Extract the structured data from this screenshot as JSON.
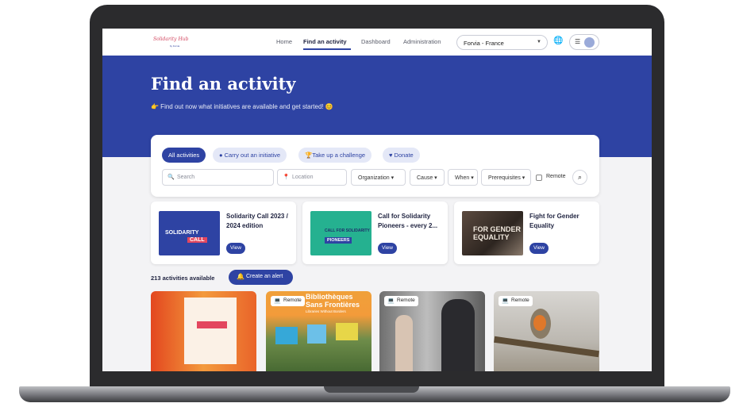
{
  "logo": {
    "text": "Solidarity Hub",
    "sub": "by Forvia"
  },
  "nav": {
    "links": [
      "Home",
      "Find an activity",
      "Dashboard",
      "Administration"
    ],
    "site_select": "Forvia - France"
  },
  "hero": {
    "title": "Find an activity",
    "subtitle": "👉 Find out now what initiatives are available and get started! 😊"
  },
  "filters": {
    "chips": [
      "All activities",
      "Carry out an initiative",
      "Take up a challenge",
      "Donate"
    ],
    "search_placeholder": "Search",
    "location_placeholder": "Location",
    "dropdowns": [
      "Organization ▾",
      "Cause ▾",
      "When ▾",
      "Prerequisites ▾"
    ],
    "remote_label": "Remote"
  },
  "featured": [
    {
      "title": "Solidarity Call 2023 / 2024 edition",
      "button": "View",
      "img_text1": "SOLIDARITY",
      "img_text2": "CALL"
    },
    {
      "title": "Call for Solidarity Pioneers - every 2...",
      "button": "View",
      "img_text1": "CALL FOR SOLIDARITY",
      "img_text2": "PIONEERS"
    },
    {
      "title": "Fight for Gender Equality",
      "button": "View",
      "img_text1": "FOR GENDER EQUALITY"
    }
  ],
  "results": {
    "count": "213 activities available",
    "alert_button": "Create an alert"
  },
  "tiles": [
    {
      "badge": "",
      "img_text": ""
    },
    {
      "badge": "Remote",
      "img_text": "Bibliothèques Sans Frontières",
      "img_sub": "Libraries Without Borders"
    },
    {
      "badge": "Remote"
    },
    {
      "badge": "Remote"
    }
  ],
  "colors": {
    "brand": "#2e43a3",
    "accent": "#e3475f",
    "background": "#f3f3f5"
  }
}
